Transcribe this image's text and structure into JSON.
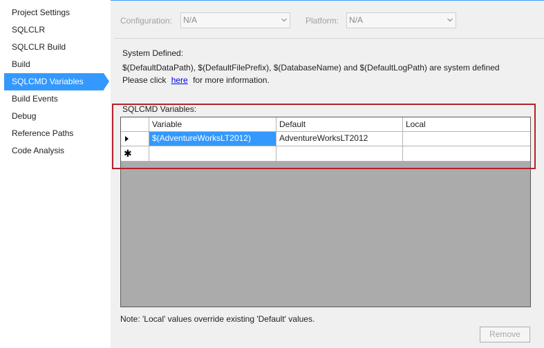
{
  "nav": {
    "items": [
      {
        "label": "Project Settings",
        "selected": false
      },
      {
        "label": "SQLCLR",
        "selected": false
      },
      {
        "label": "SQLCLR Build",
        "selected": false
      },
      {
        "label": "Build",
        "selected": false
      },
      {
        "label": "SQLCMD Variables",
        "selected": true
      },
      {
        "label": "Build Events",
        "selected": false
      },
      {
        "label": "Debug",
        "selected": false
      },
      {
        "label": "Reference Paths",
        "selected": false
      },
      {
        "label": "Code Analysis",
        "selected": false
      }
    ]
  },
  "config": {
    "configuration_label": "Configuration:",
    "configuration_value": "N/A",
    "platform_label": "Platform:",
    "platform_value": "N/A"
  },
  "system_defined": {
    "heading": "System Defined:",
    "description": "$(DefaultDataPath), $(DefaultFilePrefix), $(DatabaseName) and $(DefaultLogPath) are system defined",
    "click_prefix": "Please click",
    "link_text": "here",
    "click_suffix": "for more information."
  },
  "sqlcmd": {
    "section_label": "SQLCMD Variables:",
    "columns": [
      "Variable",
      "Default",
      "Local"
    ],
    "rows": [
      {
        "variable": "$(AdventureWorksLT2012)",
        "default": "AdventureWorksLT2012",
        "local": ""
      }
    ]
  },
  "note": "Note: 'Local' values override existing 'Default' values.",
  "buttons": {
    "remove": "Remove"
  },
  "colors": {
    "accent": "#3399ff",
    "highlight_border": "#b5202a",
    "grid_background": "#ababab"
  }
}
